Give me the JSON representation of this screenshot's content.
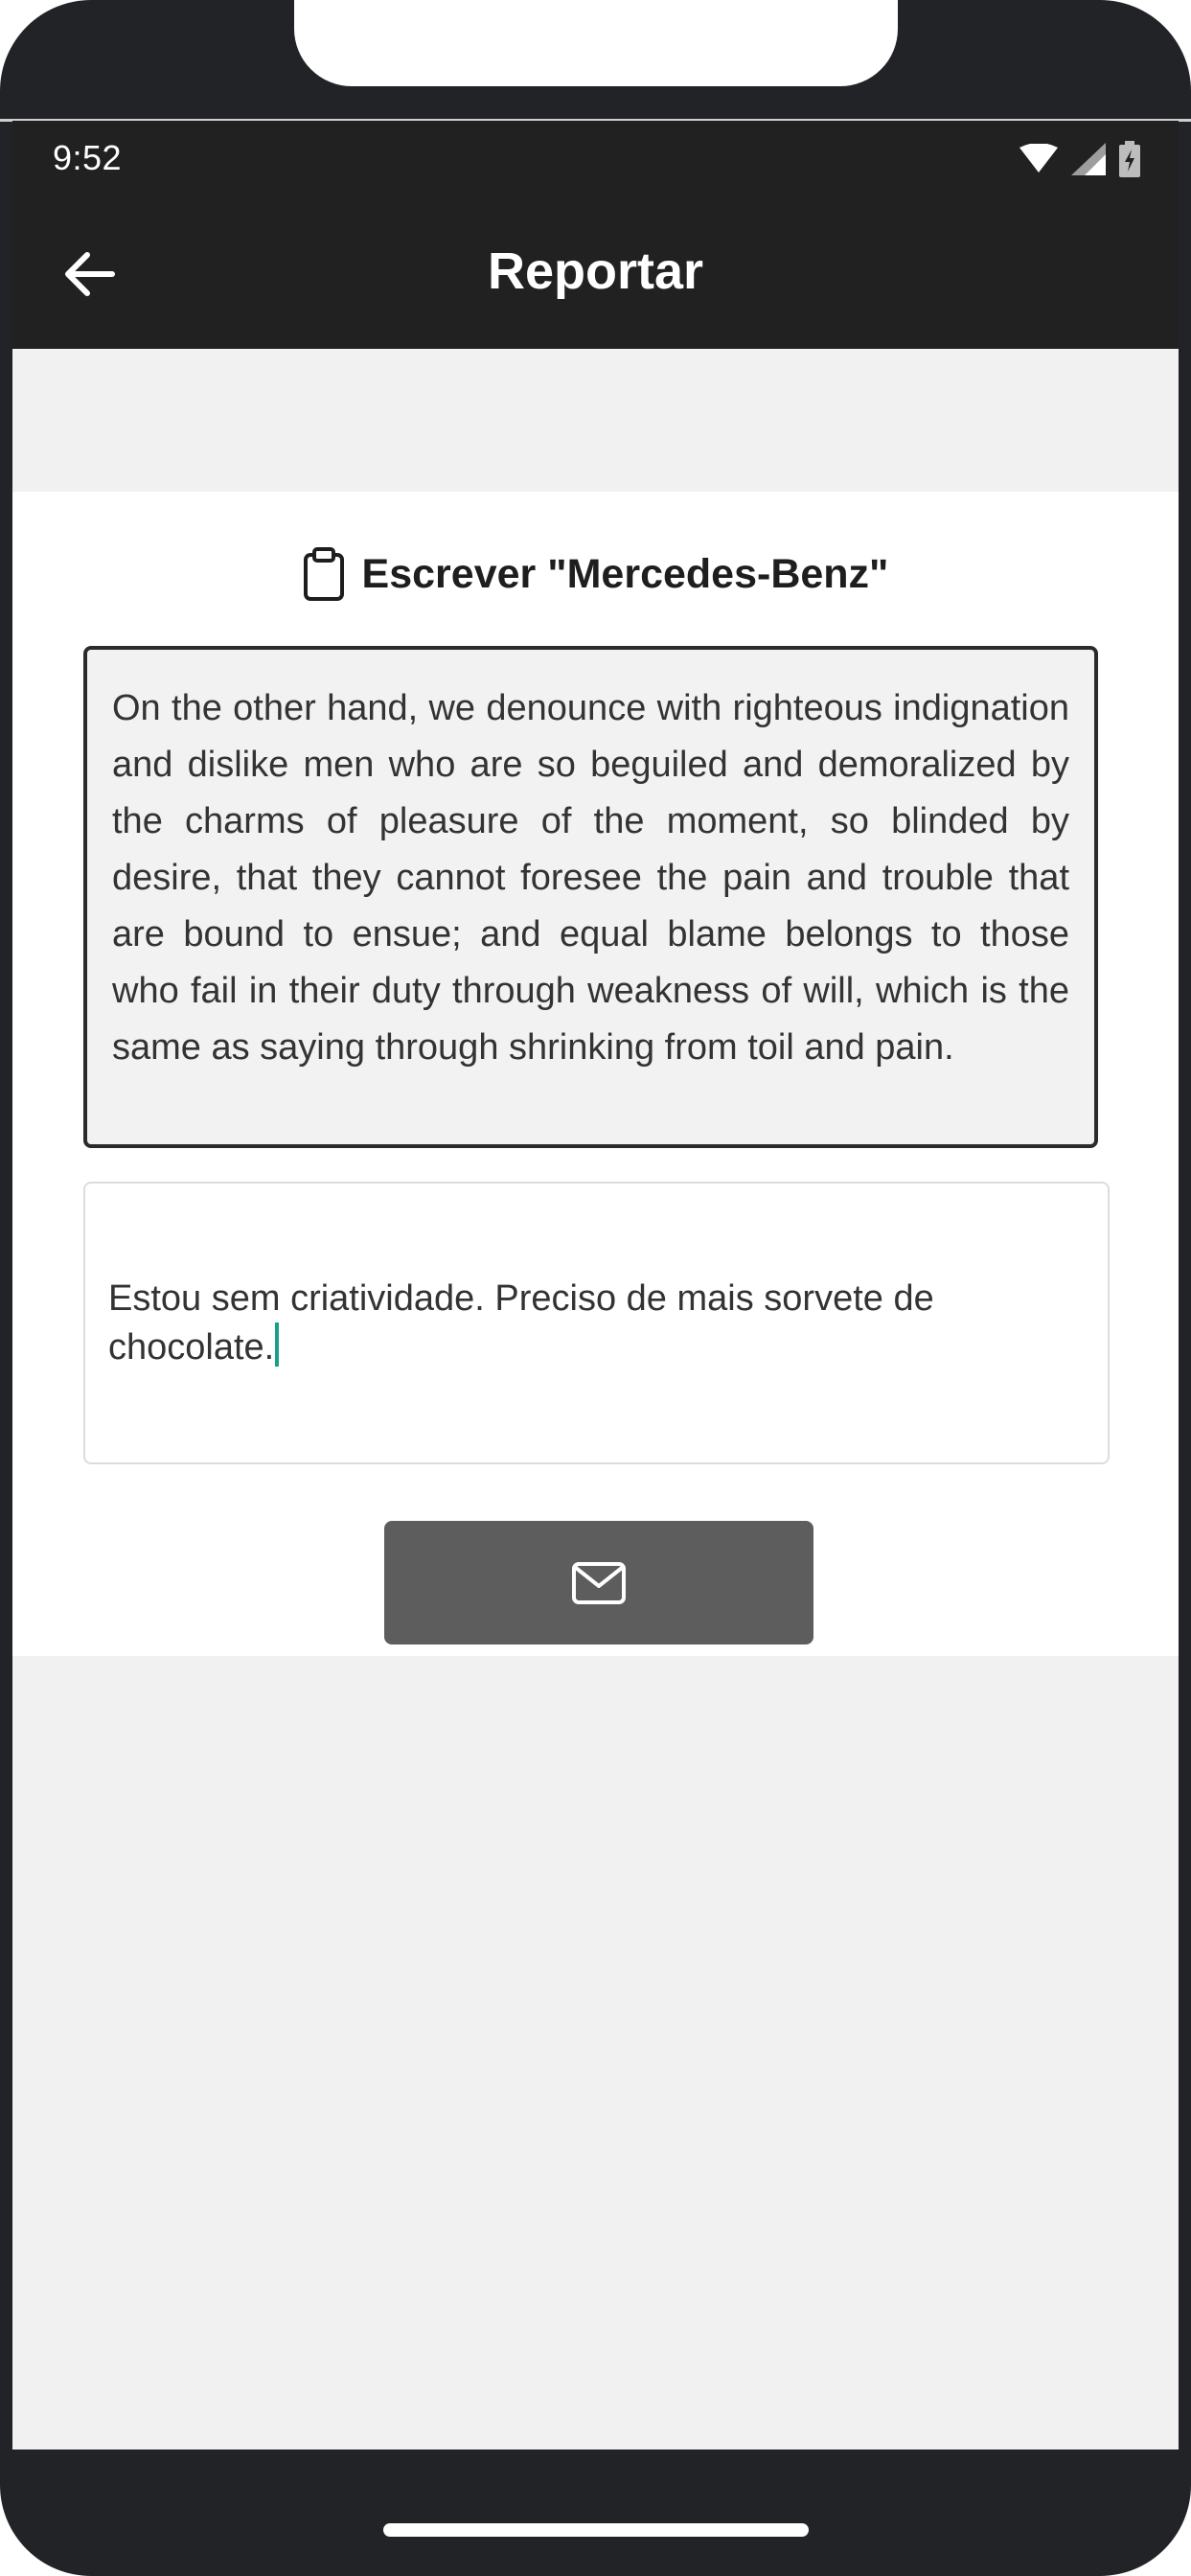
{
  "status_bar": {
    "time": "9:52",
    "icons": [
      "wifi-icon",
      "cell-signal-icon",
      "battery-charging-icon"
    ]
  },
  "app_bar": {
    "title": "Reportar",
    "back_icon": "arrow-left-icon"
  },
  "prompt": {
    "icon": "clipboard-icon",
    "text": "Escrever \"Mercedes-Benz\""
  },
  "quote": {
    "text": "On the other hand, we denounce with righteous indignation and dislike men who are so beguiled and demoralized by the charms of pleasure of the moment, so blinded by desire, that they cannot foresee the pain and trouble that are bound to ensue; and equal blame belongs to those who fail in their duty through weakness of will, which is the same as saying through shrinking from toil and pain."
  },
  "input": {
    "value": "Estou sem criatividade. Preciso de mais sorvete de chocolate."
  },
  "send_button": {
    "icon": "envelope-icon"
  },
  "colors": {
    "bar_background": "#212121",
    "button_background": "#5d5d5d",
    "caret": "#18a089",
    "page_background": "#f1f1f1"
  }
}
